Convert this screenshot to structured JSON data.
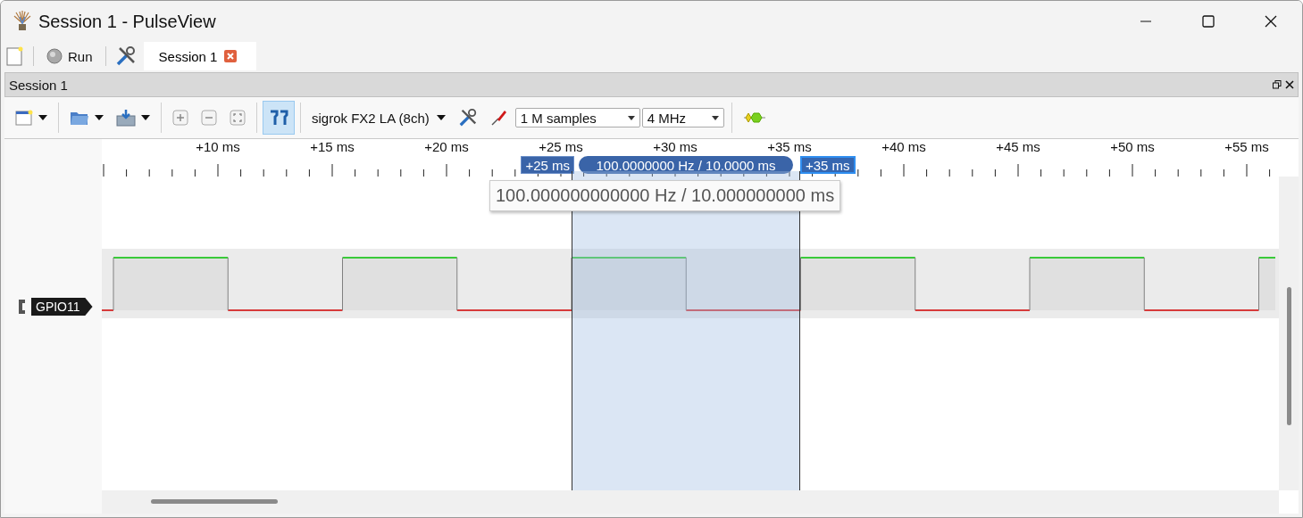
{
  "window": {
    "title": "Session 1 - PulseView"
  },
  "main_toolbar": {
    "run_button": "Run"
  },
  "tabs": [
    {
      "label": "Session 1",
      "selected": true
    }
  ],
  "dock": {
    "title": "Session 1"
  },
  "toolbar": {
    "cursors_on": true,
    "device": "sigrok FX2 LA (8ch)",
    "sample_count": "1 M samples",
    "sample_rate": "4 MHz"
  },
  "ruler": {
    "ticks": [
      "+10 ms",
      "+15 ms",
      "+20 ms",
      "+25 ms",
      "+30 ms",
      "+35 ms",
      "+40 ms",
      "+45 ms",
      "+50 ms",
      "+55 ms"
    ]
  },
  "cursors": [
    {
      "label": "+25 ms",
      "selected": false
    },
    {
      "label": "+35 ms",
      "selected": true
    }
  ],
  "cursor_span": "100.0000000 Hz / 10.0000 ms",
  "tooltip": "100.000000000000 Hz / 10.000000000 ms",
  "channels": [
    {
      "name": "GPIO11"
    }
  ]
}
